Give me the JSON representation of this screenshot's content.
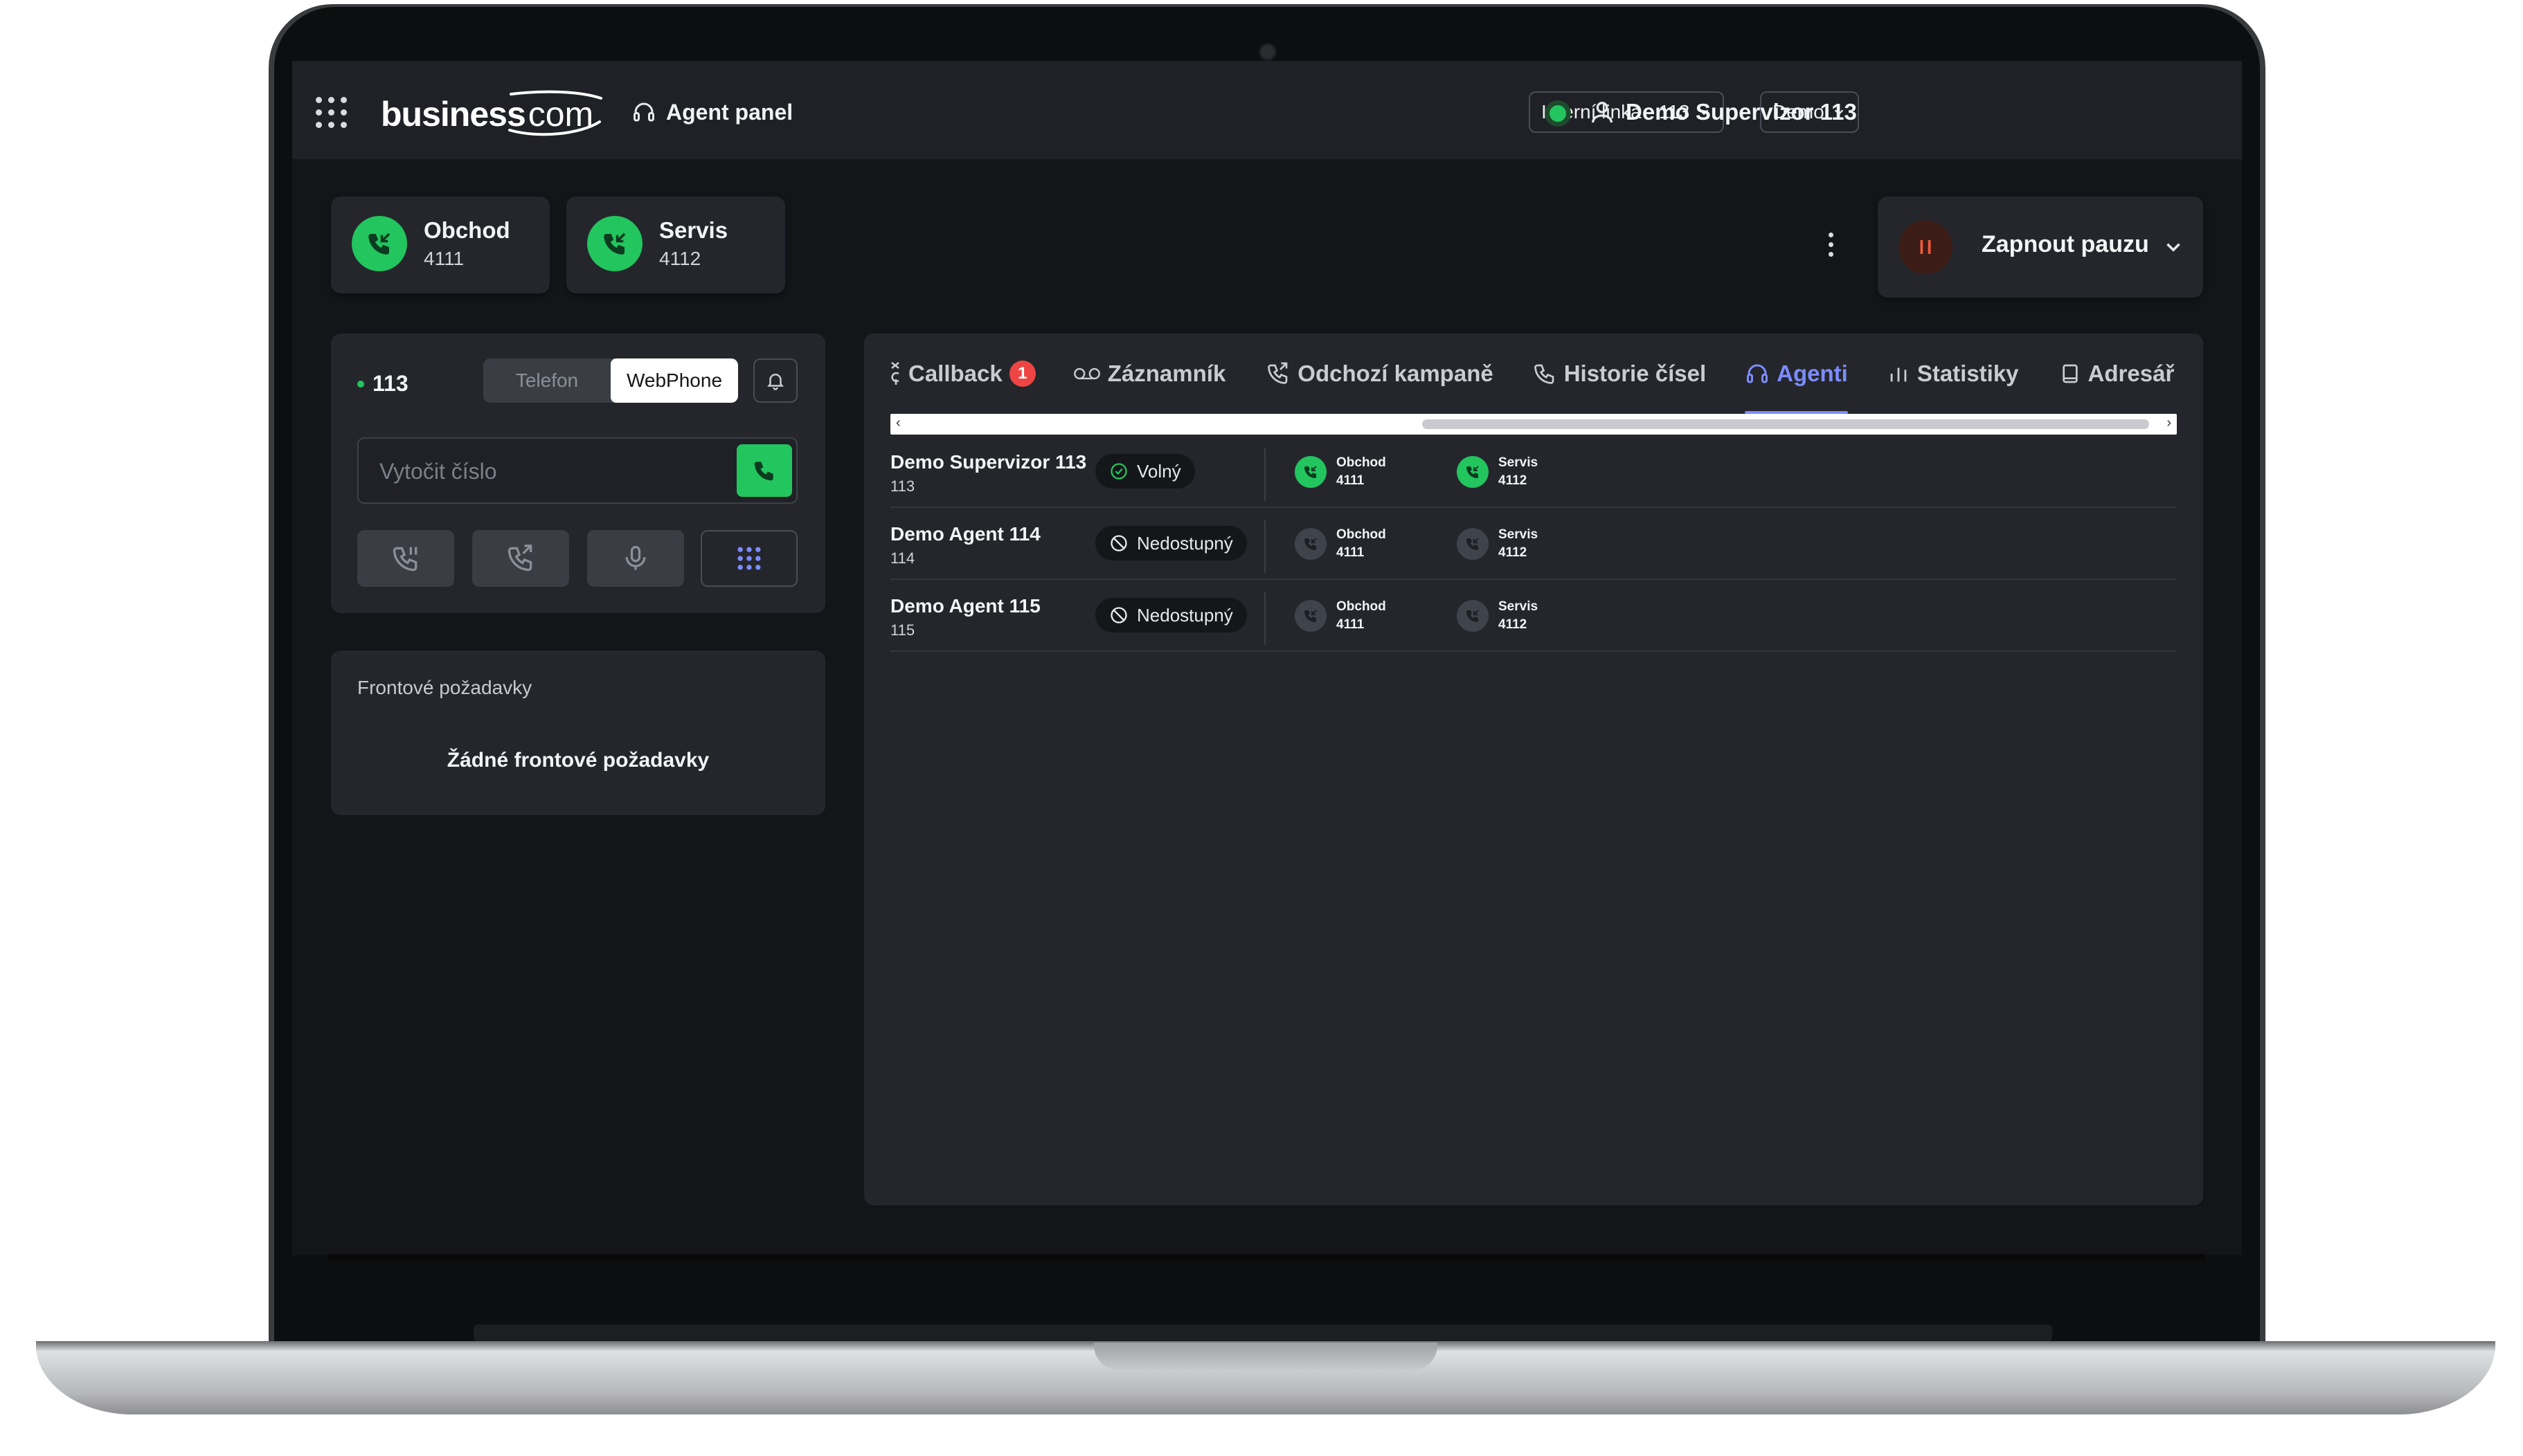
{
  "app": {
    "logo_main": "business",
    "logo_suffix": "com",
    "panel_title": "Agent panel"
  },
  "header": {
    "line_dropdown": "Interní linka - 113",
    "company_dropdown": "Demo",
    "user_name": "Demo Supervizor 113",
    "status_color": "#22c55e"
  },
  "queues": [
    {
      "name": "Obchod",
      "number": "4111"
    },
    {
      "name": "Servis",
      "number": "4112"
    }
  ],
  "pause": {
    "label": "Zapnout pauzu"
  },
  "phone": {
    "extension": "113",
    "modes": [
      "Telefon",
      "WebPhone"
    ],
    "active_mode": "WebPhone",
    "dial_placeholder": "Vytočit číslo"
  },
  "queue_requests": {
    "title": "Frontové požadavky",
    "empty": "Žádné frontové požadavky"
  },
  "tabs": [
    {
      "label": "Callback",
      "badge": "1",
      "icon": "callback-icon"
    },
    {
      "label": "Záznamník",
      "icon": "voicemail-icon"
    },
    {
      "label": "Odchozí kampaně",
      "icon": "outgoing-call-icon"
    },
    {
      "label": "Historie čísel",
      "icon": "phone-icon"
    },
    {
      "label": "Agenti",
      "icon": "headset-icon",
      "active": true
    },
    {
      "label": "Statistiky",
      "icon": "bar-chart-icon"
    },
    {
      "label": "Adresář",
      "icon": "book-icon"
    }
  ],
  "agents": [
    {
      "name": "Demo Supervizor 113",
      "ext": "113",
      "status": "Volný",
      "available": true,
      "queues": [
        {
          "name": "Obchod",
          "number": "4111"
        },
        {
          "name": "Servis",
          "number": "4112"
        }
      ]
    },
    {
      "name": "Demo Agent 114",
      "ext": "114",
      "status": "Nedostupný",
      "available": false,
      "queues": [
        {
          "name": "Obchod",
          "number": "4111"
        },
        {
          "name": "Servis",
          "number": "4112"
        }
      ]
    },
    {
      "name": "Demo Agent 115",
      "ext": "115",
      "status": "Nedostupný",
      "available": false,
      "queues": [
        {
          "name": "Obchod",
          "number": "4111"
        },
        {
          "name": "Servis",
          "number": "4112"
        }
      ]
    }
  ],
  "colors": {
    "accent": "#7c8cff",
    "green": "#22c55e",
    "badge": "#ef4444"
  }
}
